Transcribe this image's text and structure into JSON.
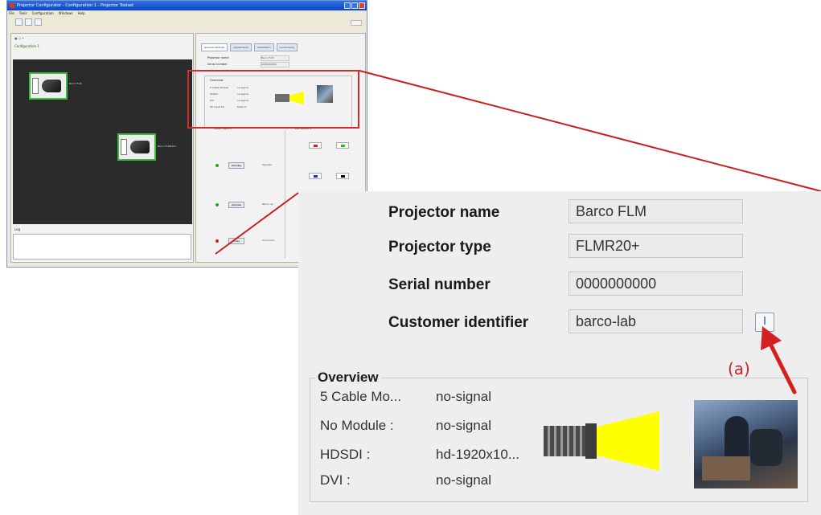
{
  "app": {
    "title": "Projector Configurator - Configuration 1 - Projector Toolset",
    "menu": [
      "File",
      "Tools",
      "Configuration",
      "Windows",
      "Help"
    ],
    "config_label": "Configuration 1",
    "log_label": "Log",
    "node1_label": "Barco FLM",
    "node2_label": "Barco FLMR20+",
    "tabs": [
      {
        "label": "General Settings",
        "active": true
      },
      {
        "label": "Adjustments",
        "active": false
      },
      {
        "label": "Installation",
        "active": false
      },
      {
        "label": "Connectivity",
        "active": false
      }
    ],
    "mini_fields": [
      {
        "label": "Projector name",
        "value": "Barco FLM"
      },
      {
        "label": "Serial number",
        "value": "0000000000"
      }
    ],
    "mini_overview": {
      "title": "Overview",
      "rows": [
        {
          "label": "5 Cable Module",
          "value": "no-signal"
        },
        {
          "label": "HDSDI",
          "value": "no-signal"
        },
        {
          "label": "DVI",
          "value": "no-signal"
        },
        {
          "label": "DP Input 5b",
          "value": "Mode 4"
        }
      ]
    },
    "sections": {
      "left": "Mode switch",
      "right": "Test pattern"
    },
    "buttons": [
      {
        "label": "Standby",
        "led": "#23a523",
        "side_label": "Operate"
      },
      {
        "label": "Operate",
        "led": "#23a523",
        "side_label": "Warm up"
      },
      {
        "label": "Close",
        "led": "#cc2020",
        "side_label": "Cool down"
      }
    ]
  },
  "zoom": {
    "fields": [
      {
        "label": "Projector name",
        "value": "Barco FLM"
      },
      {
        "label": "Projector type",
        "value": "FLMR20+"
      },
      {
        "label": "Serial number",
        "value": "0000000000"
      },
      {
        "label": "Customer identifier",
        "value": "barco-lab"
      }
    ],
    "edit_button_glyph": "I",
    "overview": {
      "title": "Overview",
      "rows": [
        {
          "label": "5 Cable Mo...",
          "value": "no-signal"
        },
        {
          "label": "No Module :",
          "value": "no-signal"
        },
        {
          "label": "HDSDI :",
          "value": "hd-1920x10..."
        },
        {
          "label": "DVI :",
          "value": "no-signal"
        }
      ]
    }
  },
  "annotation": {
    "label": "(a)",
    "color": "#cc2222"
  },
  "colors": {
    "highlight": "#d42b2b",
    "beam": "#ffff00",
    "node_border": "#3fb93f"
  }
}
